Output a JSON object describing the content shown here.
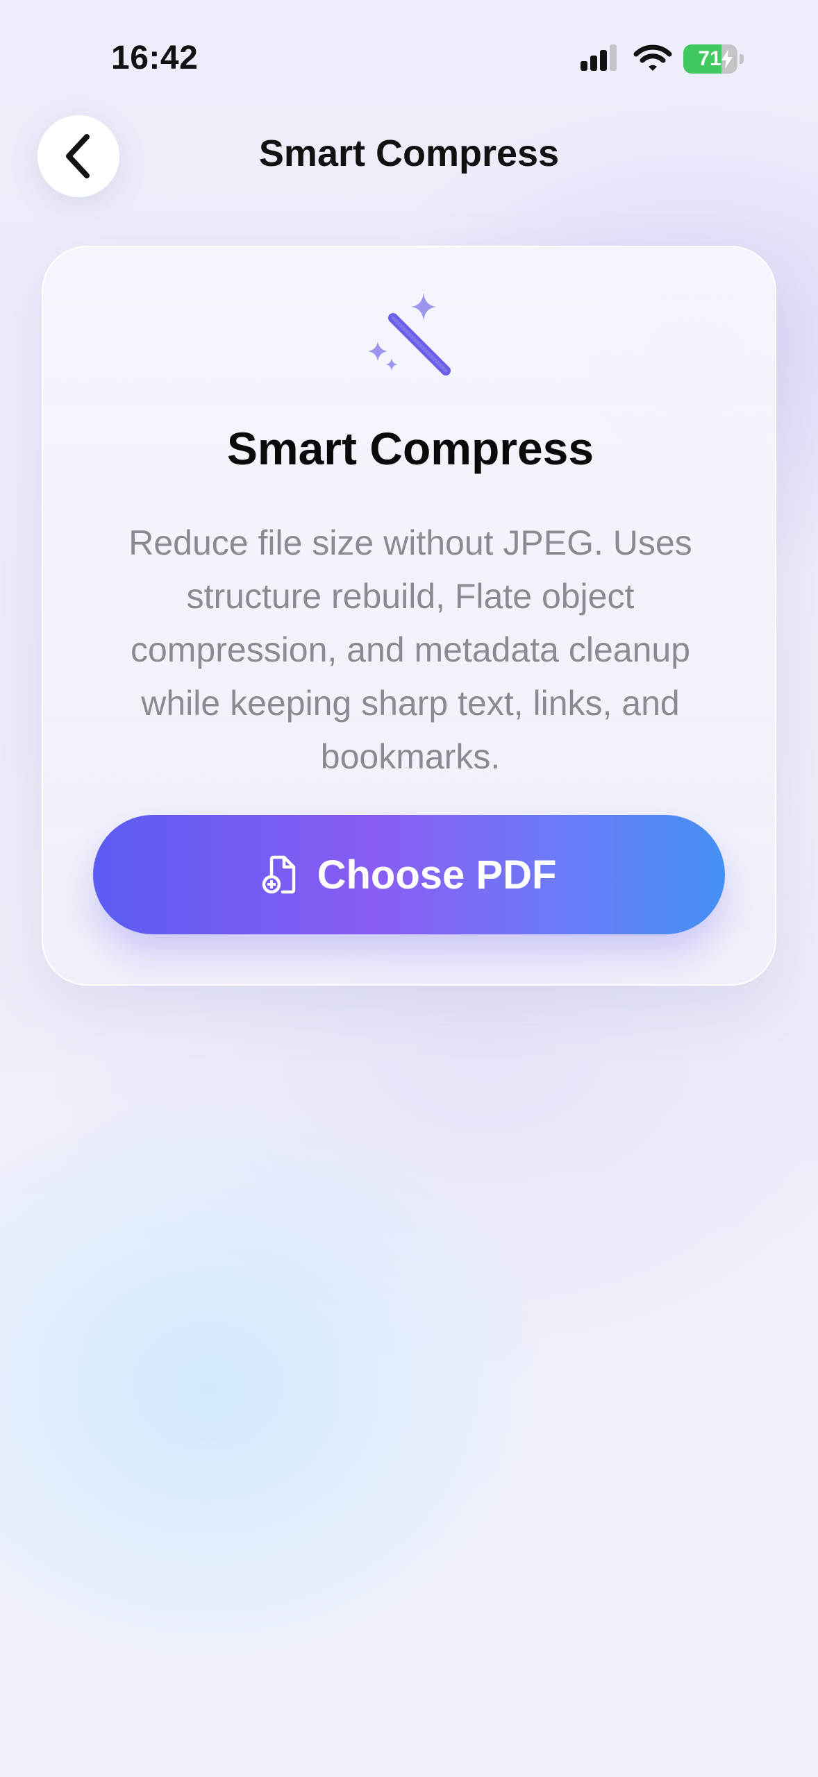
{
  "status_bar": {
    "time": "16:42",
    "battery_level": "71",
    "battery_fraction": 0.71,
    "cell_icon": "cellular-signal-icon",
    "wifi_icon": "wifi-icon",
    "charging_icon": "bolt-icon"
  },
  "nav": {
    "back_icon": "chevron-left-icon",
    "title": "Smart Compress"
  },
  "card": {
    "icon": "magic-wand-icon",
    "title": "Smart Compress",
    "description": "Reduce file size without JPEG. Uses structure rebuild, Flate object compression, and metadata cleanup while keeping sharp text, links, and bookmarks.",
    "button_icon": "file-plus-icon",
    "button_label": "Choose PDF"
  },
  "colors": {
    "accent_start": "#5b5cf2",
    "accent_mid": "#8a5df3",
    "accent_end": "#4490f4",
    "battery_green": "#3fc95e",
    "icon_purple": "#6f66e8"
  }
}
